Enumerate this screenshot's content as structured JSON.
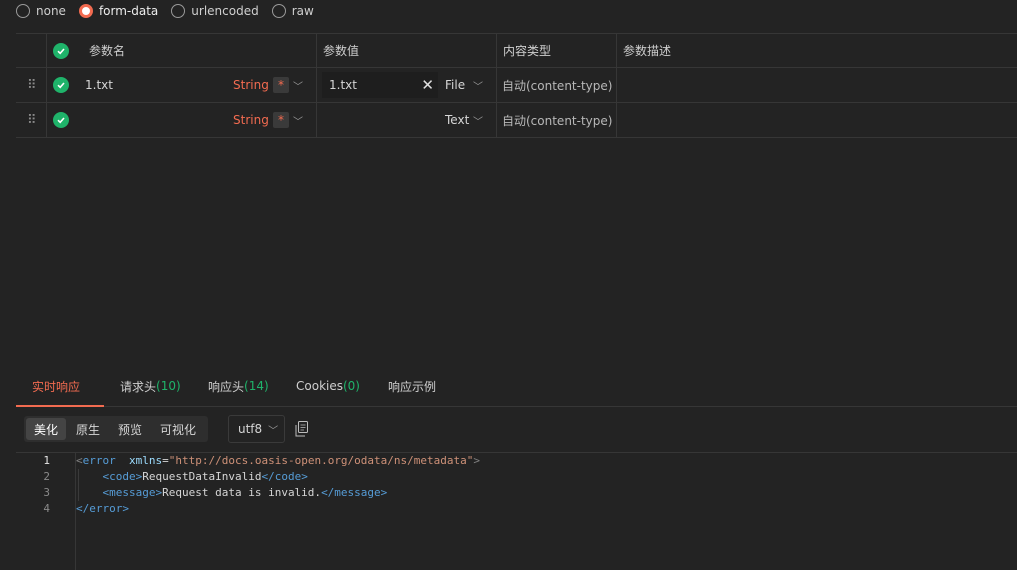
{
  "body_types": [
    {
      "label": "none",
      "selected": false
    },
    {
      "label": "form-data",
      "selected": true
    },
    {
      "label": "urlencoded",
      "selected": false
    },
    {
      "label": "raw",
      "selected": false
    }
  ],
  "params_table": {
    "headers": {
      "name": "参数名",
      "value": "参数值",
      "content_type": "内容类型",
      "description": "参数描述"
    },
    "rows": [
      {
        "name": "1.txt",
        "type": "String",
        "required_mark": "*",
        "value": "1.txt",
        "value_kind": "File",
        "content_type": "自动(content-type)"
      },
      {
        "name": "",
        "type": "String",
        "required_mark": "*",
        "value": "",
        "value_kind": "Text",
        "content_type": "自动(content-type)"
      }
    ]
  },
  "response_tabs": [
    {
      "label": "实时响应",
      "count": "",
      "active": true
    },
    {
      "label": "请求头",
      "count": "(10)",
      "active": false
    },
    {
      "label": "响应头",
      "count": "(14)",
      "active": false
    },
    {
      "label": "Cookies",
      "count": "(0)",
      "active": false
    },
    {
      "label": "响应示例",
      "count": "",
      "active": false
    }
  ],
  "view_modes": [
    "美化",
    "原生",
    "预览",
    "可视化"
  ],
  "active_view_mode": "美化",
  "encoding": "utf8",
  "code_lines": [
    "1",
    "2",
    "3",
    "4"
  ],
  "code": {
    "l1": {
      "open": "<",
      "tag": "error",
      "attr": "xmlns",
      "eq": "=",
      "val": "\"http://docs.oasis-open.org/odata/ns/metadata\"",
      "close": ">"
    },
    "l2": {
      "open_tag": "<code>",
      "text": "RequestDataInvalid",
      "close_tag": "</code>"
    },
    "l3": {
      "open_tag": "<message>",
      "text": "Request data is invalid.",
      "close_tag": "</message>"
    },
    "l4": {
      "close_tag": "</error>"
    }
  },
  "colors": {
    "accent": "#f26b50",
    "success": "#1fb36a",
    "background": "#232323"
  }
}
